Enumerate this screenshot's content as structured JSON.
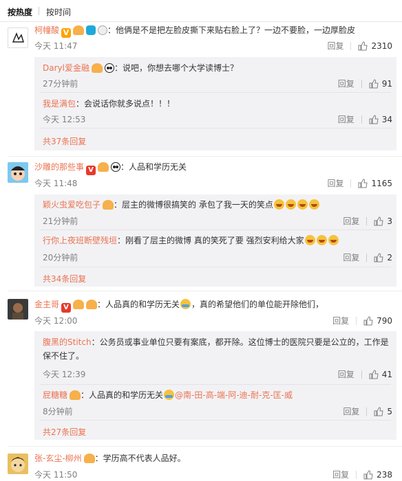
{
  "sort_tabs": {
    "hot": "按热度",
    "time": "按时间"
  },
  "comments": [
    {
      "user": "柯幢酸",
      "text": "：他俩是不是把左脸皮撕下来贴右脸上了？一边不要脸，一边厚脸皮",
      "time": "今天 11:47",
      "reply_label": "回复",
      "likes": "2310",
      "replies": [
        {
          "user": "Daryl爱金融",
          "text": "：说吧，你想去哪个大学读博士？",
          "time": "27分钟前",
          "reply_label": "回复",
          "likes": "91"
        },
        {
          "user": "我是满包",
          "text": "：会说话你就多说点！！！",
          "time": "今天 12:53",
          "reply_label": "回复",
          "likes": "34"
        }
      ],
      "more": "共37条回复"
    },
    {
      "user": "沙雕的那些事",
      "text": "：人品和学历无关",
      "time": "今天 11:48",
      "reply_label": "回复",
      "likes": "1165",
      "replies": [
        {
          "user": "颖火虫爱吃包子",
          "text": "：层主的微博很搞笑的 承包了我一天的笑点",
          "time": "21分钟前",
          "reply_label": "回复",
          "likes": "3"
        },
        {
          "user": "行你上夜班断壁残垣",
          "text": "：刚看了层主的微博 真的笑死了要 强烈安利给大家",
          "time": "20分钟前",
          "reply_label": "回复",
          "likes": "2"
        }
      ],
      "more": "共34条回复"
    },
    {
      "user": "金主哥",
      "text_a": "：人品真的和学历无关",
      "text_b": "，真的希望他们的单位能开除他们，",
      "time": "今天 12:00",
      "reply_label": "回复",
      "likes": "790",
      "replies": [
        {
          "user": "腹黑的Stitch",
          "text": "：公务员或事业单位只要有案底，都开除。这位博士的医院只要是公立的，工作是保不住了。",
          "time": "今天 12:39",
          "reply_label": "回复",
          "likes": "41"
        },
        {
          "user": "屁糖糖",
          "text": "：人品真的和学历无关",
          "mention": "@南-田-高-端-阿-迪-耐-克-匡-威",
          "time": "8分钟前",
          "reply_label": "回复",
          "likes": "5"
        }
      ],
      "more": "共27条回复"
    },
    {
      "user": "张-玄尘-柳州",
      "text": "：学历高不代表人品好。",
      "time": "今天 11:50",
      "reply_label": "回复",
      "likes": "238"
    }
  ],
  "colors": {
    "username": "#eb7350",
    "reply_bg": "#f2f2f5",
    "meta": "#808080"
  }
}
